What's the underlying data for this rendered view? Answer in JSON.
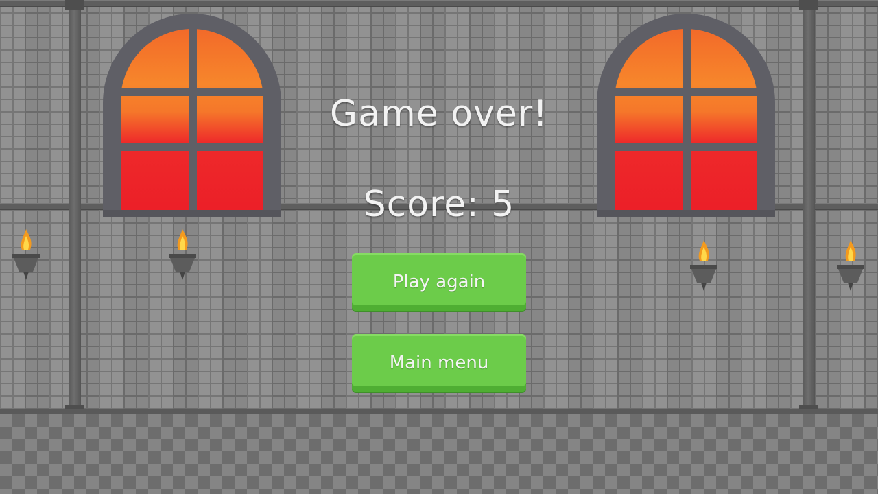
{
  "game_over": {
    "title": "Game over!",
    "score_text": "Score: 5"
  },
  "buttons": {
    "play_again_label": "Play again",
    "main_menu_label": "Main menu"
  },
  "colors": {
    "button_green": "#6ccc4a",
    "text_white": "#f2f2f2",
    "window_glass_top": "#f7862b",
    "window_glass_bottom": "#ec1f28"
  }
}
